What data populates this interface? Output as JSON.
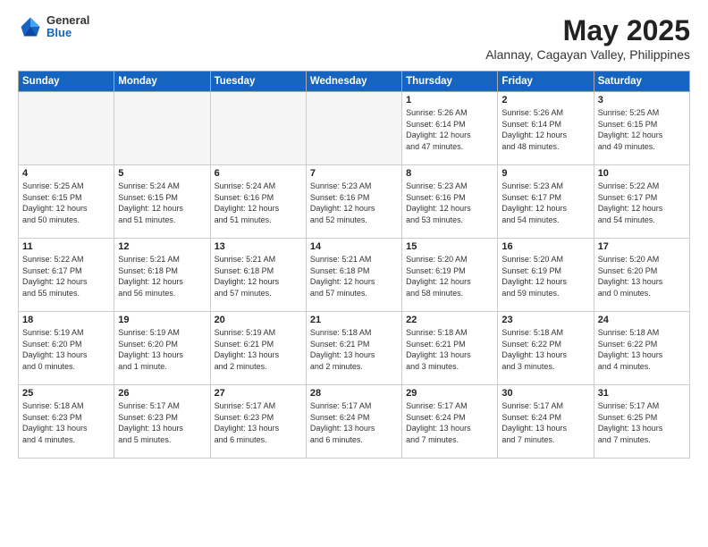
{
  "header": {
    "logo_general": "General",
    "logo_blue": "Blue",
    "month_title": "May 2025",
    "subtitle": "Alannay, Cagayan Valley, Philippines"
  },
  "weekdays": [
    "Sunday",
    "Monday",
    "Tuesday",
    "Wednesday",
    "Thursday",
    "Friday",
    "Saturday"
  ],
  "weeks": [
    [
      {
        "day": "",
        "info": ""
      },
      {
        "day": "",
        "info": ""
      },
      {
        "day": "",
        "info": ""
      },
      {
        "day": "",
        "info": ""
      },
      {
        "day": "1",
        "info": "Sunrise: 5:26 AM\nSunset: 6:14 PM\nDaylight: 12 hours\nand 47 minutes."
      },
      {
        "day": "2",
        "info": "Sunrise: 5:26 AM\nSunset: 6:14 PM\nDaylight: 12 hours\nand 48 minutes."
      },
      {
        "day": "3",
        "info": "Sunrise: 5:25 AM\nSunset: 6:15 PM\nDaylight: 12 hours\nand 49 minutes."
      }
    ],
    [
      {
        "day": "4",
        "info": "Sunrise: 5:25 AM\nSunset: 6:15 PM\nDaylight: 12 hours\nand 50 minutes."
      },
      {
        "day": "5",
        "info": "Sunrise: 5:24 AM\nSunset: 6:15 PM\nDaylight: 12 hours\nand 51 minutes."
      },
      {
        "day": "6",
        "info": "Sunrise: 5:24 AM\nSunset: 6:16 PM\nDaylight: 12 hours\nand 51 minutes."
      },
      {
        "day": "7",
        "info": "Sunrise: 5:23 AM\nSunset: 6:16 PM\nDaylight: 12 hours\nand 52 minutes."
      },
      {
        "day": "8",
        "info": "Sunrise: 5:23 AM\nSunset: 6:16 PM\nDaylight: 12 hours\nand 53 minutes."
      },
      {
        "day": "9",
        "info": "Sunrise: 5:23 AM\nSunset: 6:17 PM\nDaylight: 12 hours\nand 54 minutes."
      },
      {
        "day": "10",
        "info": "Sunrise: 5:22 AM\nSunset: 6:17 PM\nDaylight: 12 hours\nand 54 minutes."
      }
    ],
    [
      {
        "day": "11",
        "info": "Sunrise: 5:22 AM\nSunset: 6:17 PM\nDaylight: 12 hours\nand 55 minutes."
      },
      {
        "day": "12",
        "info": "Sunrise: 5:21 AM\nSunset: 6:18 PM\nDaylight: 12 hours\nand 56 minutes."
      },
      {
        "day": "13",
        "info": "Sunrise: 5:21 AM\nSunset: 6:18 PM\nDaylight: 12 hours\nand 57 minutes."
      },
      {
        "day": "14",
        "info": "Sunrise: 5:21 AM\nSunset: 6:18 PM\nDaylight: 12 hours\nand 57 minutes."
      },
      {
        "day": "15",
        "info": "Sunrise: 5:20 AM\nSunset: 6:19 PM\nDaylight: 12 hours\nand 58 minutes."
      },
      {
        "day": "16",
        "info": "Sunrise: 5:20 AM\nSunset: 6:19 PM\nDaylight: 12 hours\nand 59 minutes."
      },
      {
        "day": "17",
        "info": "Sunrise: 5:20 AM\nSunset: 6:20 PM\nDaylight: 13 hours\nand 0 minutes."
      }
    ],
    [
      {
        "day": "18",
        "info": "Sunrise: 5:19 AM\nSunset: 6:20 PM\nDaylight: 13 hours\nand 0 minutes."
      },
      {
        "day": "19",
        "info": "Sunrise: 5:19 AM\nSunset: 6:20 PM\nDaylight: 13 hours\nand 1 minute."
      },
      {
        "day": "20",
        "info": "Sunrise: 5:19 AM\nSunset: 6:21 PM\nDaylight: 13 hours\nand 2 minutes."
      },
      {
        "day": "21",
        "info": "Sunrise: 5:18 AM\nSunset: 6:21 PM\nDaylight: 13 hours\nand 2 minutes."
      },
      {
        "day": "22",
        "info": "Sunrise: 5:18 AM\nSunset: 6:21 PM\nDaylight: 13 hours\nand 3 minutes."
      },
      {
        "day": "23",
        "info": "Sunrise: 5:18 AM\nSunset: 6:22 PM\nDaylight: 13 hours\nand 3 minutes."
      },
      {
        "day": "24",
        "info": "Sunrise: 5:18 AM\nSunset: 6:22 PM\nDaylight: 13 hours\nand 4 minutes."
      }
    ],
    [
      {
        "day": "25",
        "info": "Sunrise: 5:18 AM\nSunset: 6:23 PM\nDaylight: 13 hours\nand 4 minutes."
      },
      {
        "day": "26",
        "info": "Sunrise: 5:17 AM\nSunset: 6:23 PM\nDaylight: 13 hours\nand 5 minutes."
      },
      {
        "day": "27",
        "info": "Sunrise: 5:17 AM\nSunset: 6:23 PM\nDaylight: 13 hours\nand 6 minutes."
      },
      {
        "day": "28",
        "info": "Sunrise: 5:17 AM\nSunset: 6:24 PM\nDaylight: 13 hours\nand 6 minutes."
      },
      {
        "day": "29",
        "info": "Sunrise: 5:17 AM\nSunset: 6:24 PM\nDaylight: 13 hours\nand 7 minutes."
      },
      {
        "day": "30",
        "info": "Sunrise: 5:17 AM\nSunset: 6:24 PM\nDaylight: 13 hours\nand 7 minutes."
      },
      {
        "day": "31",
        "info": "Sunrise: 5:17 AM\nSunset: 6:25 PM\nDaylight: 13 hours\nand 7 minutes."
      }
    ]
  ]
}
